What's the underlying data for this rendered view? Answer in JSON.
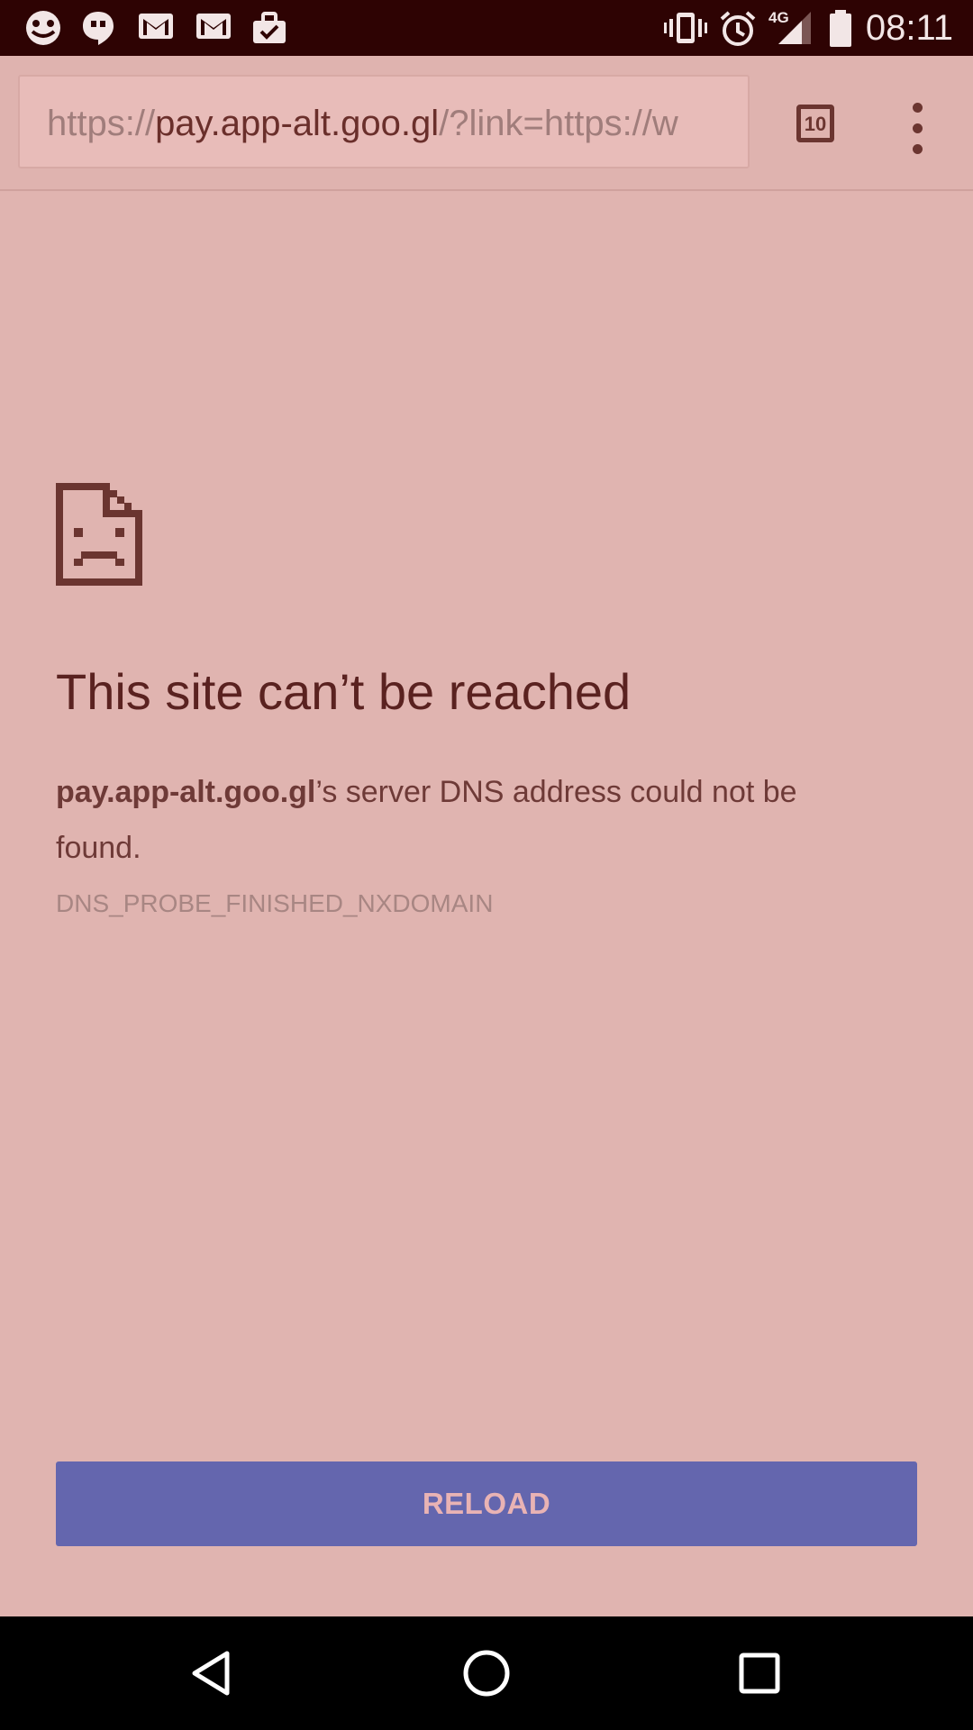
{
  "status_bar": {
    "time": "08:11",
    "network": "4G",
    "notification_icons": [
      "hangouts-icon",
      "quote-icon",
      "gmail-icon",
      "gmail-icon",
      "briefcase-icon"
    ],
    "system_icons": [
      "vibrate-icon",
      "alarm-icon",
      "signal-icon",
      "battery-icon"
    ]
  },
  "toolbar": {
    "url_scheme": "https://",
    "url_host": "pay.app-alt.goo.gl",
    "url_rest": "/?link=https://w",
    "tab_count": "10",
    "menu_icon": "more-vert-icon"
  },
  "error_page": {
    "icon": "sad-page-icon",
    "title": "This site can’t be reached",
    "host": "pay.app-alt.goo.gl",
    "message_rest": "’s server DNS address could not be found.",
    "error_code": "DNS_PROBE_FINISHED_NXDOMAIN",
    "reload_label": "RELOAD"
  },
  "nav_bar": {
    "buttons": [
      "back-icon",
      "home-icon",
      "recents-icon"
    ]
  }
}
